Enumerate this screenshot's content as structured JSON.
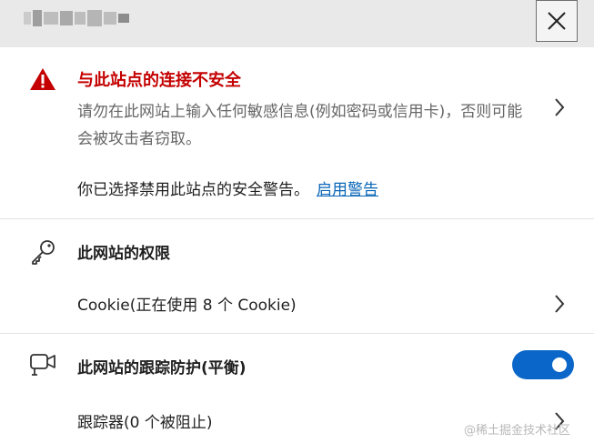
{
  "header": {
    "site_name_obscured": true,
    "close_icon": "close-icon"
  },
  "security_warning": {
    "icon": "warning-triangle-icon",
    "title": "与此站点的连接不安全",
    "description": "请勿在此网站上输入任何敏感信息(例如密码或信用卡)，否则可能会被攻击者窃取。",
    "note": "你已选择禁用此站点的安全警告。",
    "link_label": "启用警告",
    "title_color": "#c40000",
    "link_color": "#0a66b8"
  },
  "permissions": {
    "icon": "key-icon",
    "title": "此网站的权限",
    "cookie_label": "Cookie(正在使用 8 个 Cookie)"
  },
  "tracking": {
    "icon": "tracking-camera-icon",
    "title": "此网站的跟踪防护(平衡)",
    "toggle_on": true,
    "toggle_color": "#0a66c8",
    "trackers_label": "跟踪器(0 个被阻止)"
  },
  "watermark": "@稀土掘金技术社区"
}
